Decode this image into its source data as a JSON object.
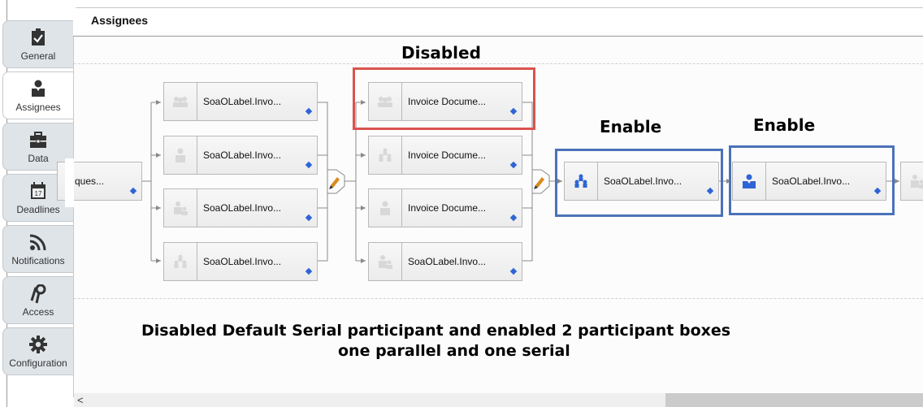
{
  "sidebar": {
    "items": [
      {
        "label": "General",
        "icon": "clipboard-check-icon",
        "active": false
      },
      {
        "label": "Assignees",
        "icon": "user-icon",
        "active": true
      },
      {
        "label": "Data",
        "icon": "briefcase-icon",
        "active": false
      },
      {
        "label": "Deadlines",
        "icon": "calendar-icon",
        "active": false,
        "icon_text": "17"
      },
      {
        "label": "Notifications",
        "icon": "rss-icon",
        "active": false
      },
      {
        "label": "Access",
        "icon": "keys-icon",
        "active": false
      },
      {
        "label": "Configuration",
        "icon": "gear-icon",
        "active": false
      }
    ]
  },
  "panel": {
    "title": "Assignees"
  },
  "diagram": {
    "start_box": {
      "label": "ques..."
    },
    "group1": [
      {
        "label": "SoaOLabel.Invo...",
        "icon": "group-icon"
      },
      {
        "label": "SoaOLabel.Invo...",
        "icon": "user-icon"
      },
      {
        "label": "SoaOLabel.Invo...",
        "icon": "user-group-icon"
      },
      {
        "label": "SoaOLabel.Invo...",
        "icon": "hierarchy-icon"
      }
    ],
    "group2": [
      {
        "label": "Invoice Docume...",
        "icon": "group-icon"
      },
      {
        "label": "Invoice Docume...",
        "icon": "hierarchy-icon"
      },
      {
        "label": "Invoice Docume...",
        "icon": "user-icon"
      },
      {
        "label": "SoaOLabel.Invo...",
        "icon": "user-group-icon"
      }
    ],
    "enabled_parallel": {
      "label": "SoaOLabel.Invo...",
      "icon": "hierarchy-icon"
    },
    "enabled_serial": {
      "label": "SoaOLabel.Invo...",
      "icon": "user-icon"
    },
    "trailing_box": {
      "icon": "user-group-icon"
    }
  },
  "annotations": {
    "disabled": "Disabled",
    "enable1": "Enable",
    "enable2": "Enable",
    "caption_line1": "Disabled Default Serial participant and enabled 2 participant boxes",
    "caption_line2": "one parallel and one serial"
  },
  "colors": {
    "disabled_highlight": "#d9534f",
    "enabled_highlight": "#4a72b8",
    "marker": "#2f64d6",
    "enabled_icon": "#2f64d6"
  },
  "scrollbar": {
    "left_arrow": "<"
  }
}
